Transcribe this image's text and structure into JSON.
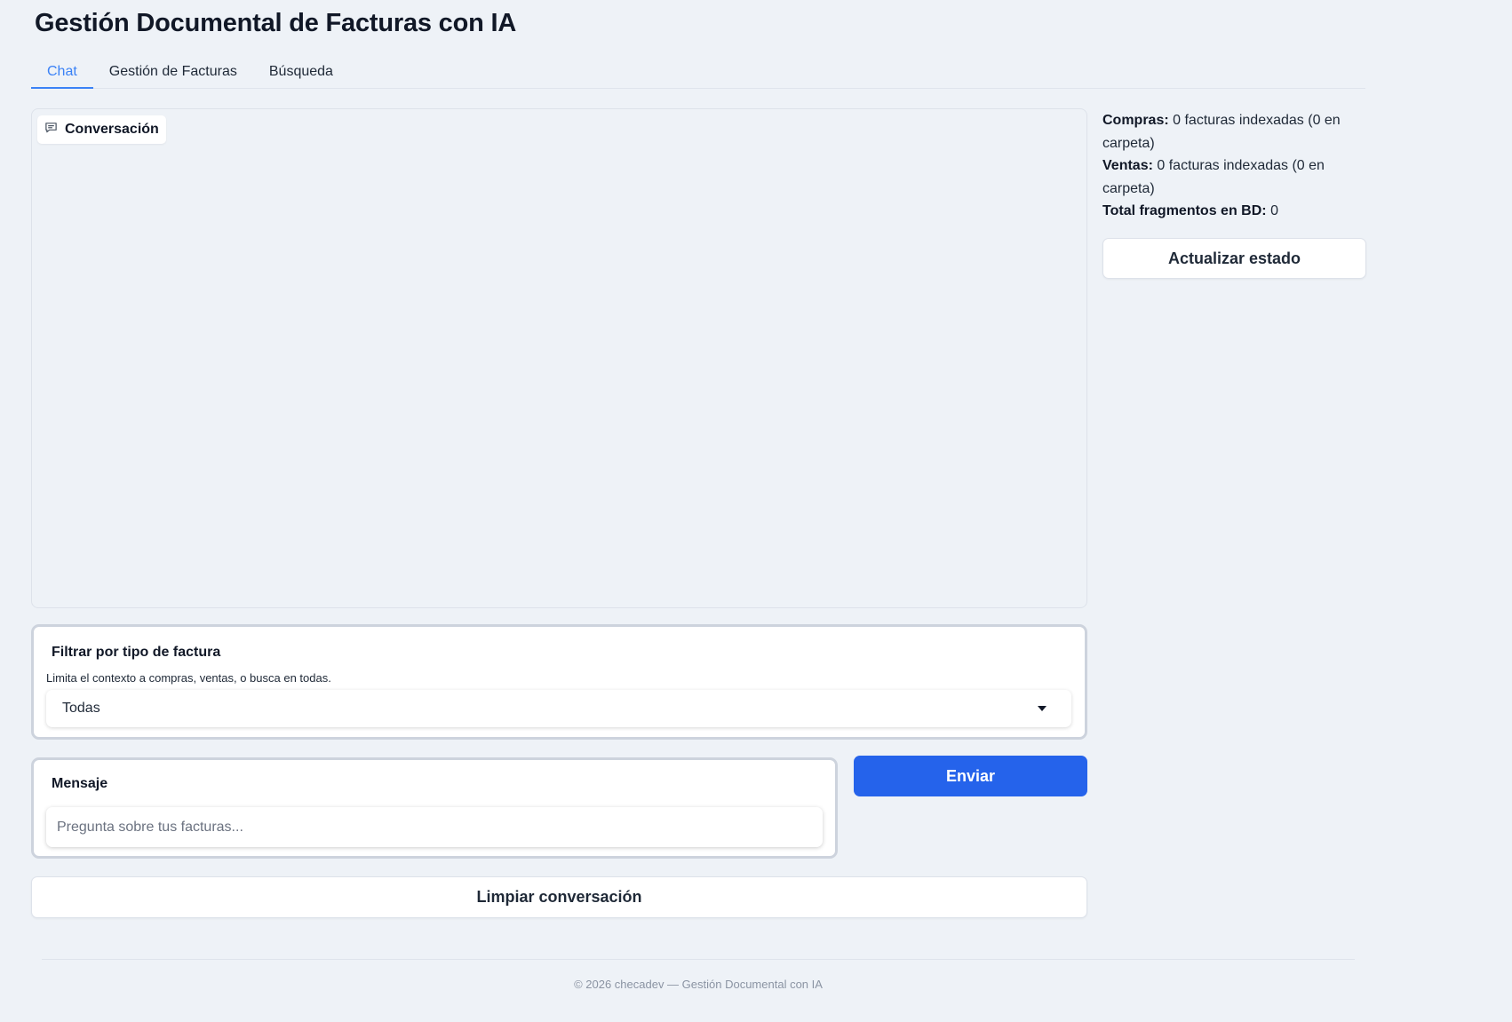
{
  "app": {
    "title": "Gestión Documental de Facturas con IA"
  },
  "tabs": [
    {
      "label": "Chat",
      "active": true
    },
    {
      "label": "Gestión de Facturas",
      "active": false
    },
    {
      "label": "Búsqueda",
      "active": false
    }
  ],
  "chat": {
    "label": "Conversación",
    "icon": "chat-bubble-icon",
    "messages": []
  },
  "status": {
    "compras_label": "Compras:",
    "compras_value": "0 facturas indexadas (0 en carpeta)",
    "ventas_label": "Ventas:",
    "ventas_value": "0 facturas indexadas (0 en carpeta)",
    "total_label": "Total fragmentos en BD:",
    "total_value": "0",
    "refresh_label": "Actualizar estado"
  },
  "filter": {
    "title": "Filtrar por tipo de factura",
    "description": "Limita el contexto a compras, ventas, o busca en todas.",
    "selected": "Todas"
  },
  "message": {
    "title": "Mensaje",
    "placeholder": "Pregunta sobre tus facturas...",
    "value": ""
  },
  "actions": {
    "send_label": "Enviar",
    "clear_label": "Limpiar conversación"
  },
  "footer": {
    "text": "© 2026 checadev — Gestión Documental con IA"
  },
  "colors": {
    "accent": "#2563eb",
    "active_tab": "#3b82f6",
    "background": "#eef2f7"
  }
}
